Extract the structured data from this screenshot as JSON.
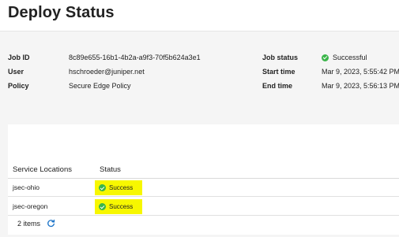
{
  "header": {
    "title": "Deploy Status"
  },
  "details": {
    "job_id_label": "Job ID",
    "job_id_value": "8c89e655-16b1-4b2a-a9f3-70f5b624a3e1",
    "user_label": "User",
    "user_value": "hschroeder@juniper.net",
    "policy_label": "Policy",
    "policy_value": "Secure Edge Policy",
    "job_status_label": "Job status",
    "job_status_value": "Successful",
    "start_time_label": "Start time",
    "start_time_value": "Mar 9, 2023, 5:55:42 PM",
    "end_time_label": "End time",
    "end_time_value": "Mar 9, 2023, 5:56:13 PM"
  },
  "table": {
    "columns": [
      "Service Locations",
      "Status"
    ],
    "rows": [
      {
        "location": "jsec-ohio",
        "status": "Success"
      },
      {
        "location": "jsec-oregon",
        "status": "Success"
      }
    ],
    "footer_count": "2 items"
  },
  "colors": {
    "success": "#3bb54a",
    "highlight": "#f7f700",
    "refresh": "#1a73c8"
  },
  "icons": {
    "status": "check-circle-icon",
    "refresh": "refresh-icon"
  }
}
